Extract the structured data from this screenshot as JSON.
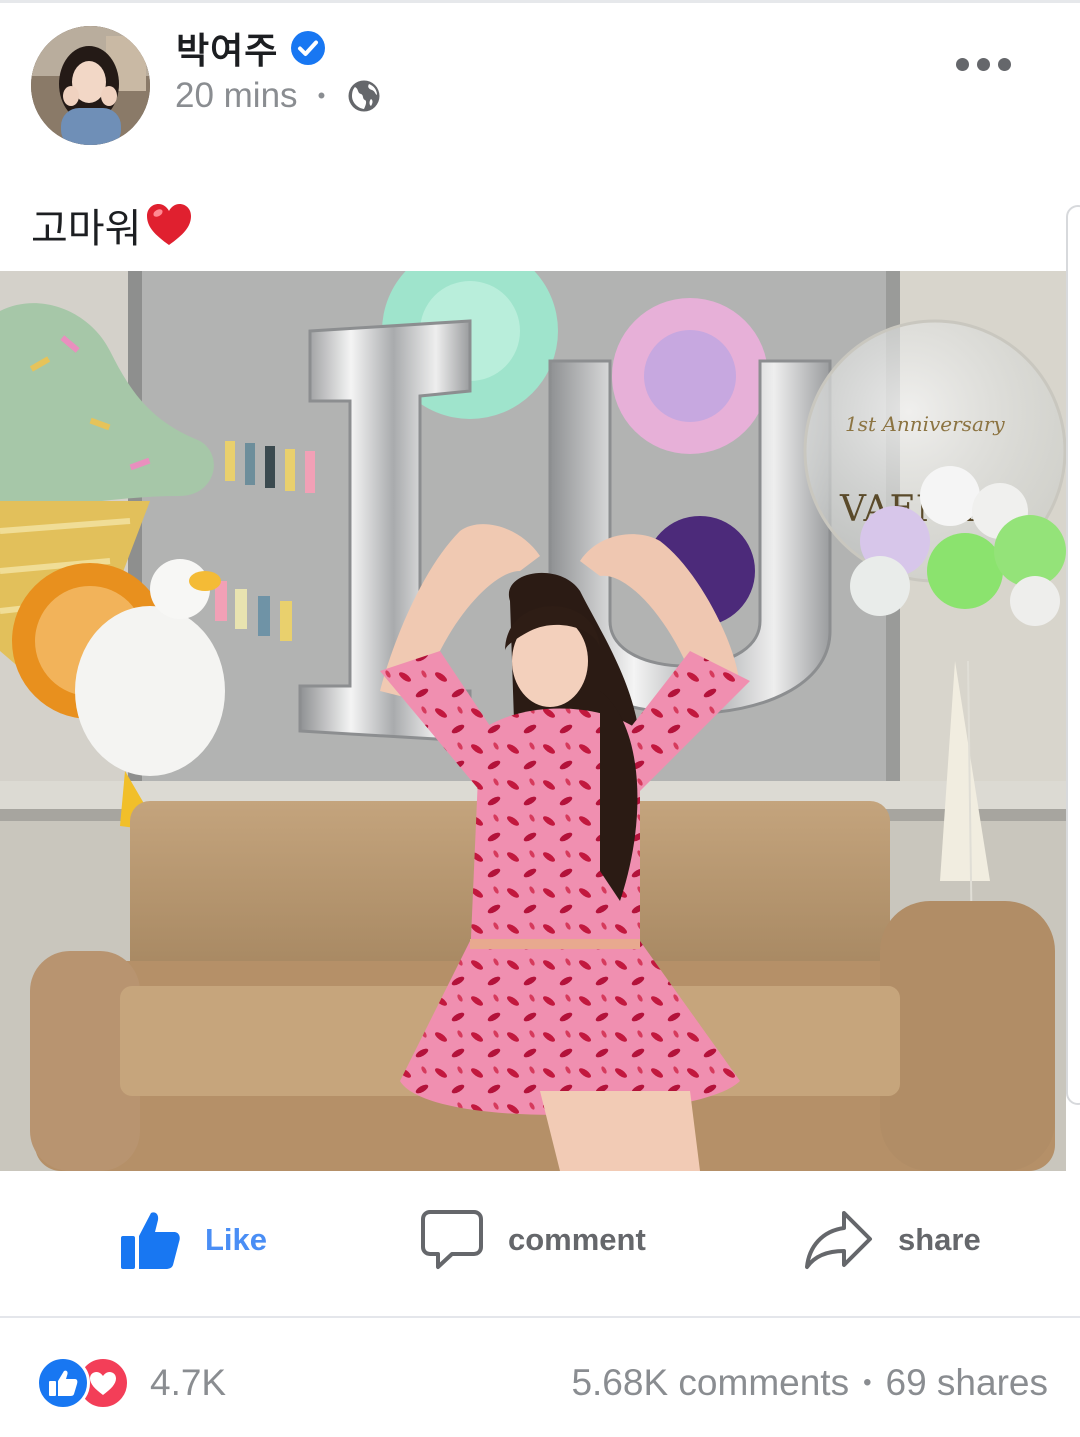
{
  "post": {
    "author": "박여주",
    "verified": true,
    "time": "20 mins",
    "separator": "•",
    "audience_icon": "globe-icon",
    "menu_icon": "more-dots-icon",
    "caption": "고마워",
    "caption_emoji": "red-heart-emoji",
    "photo": {
      "balloon_text": "VAENA",
      "balloon_subtext": "1st Anniversary"
    }
  },
  "actions": {
    "like_label": "Like",
    "comment_label": "comment",
    "share_label": "share"
  },
  "stats": {
    "reaction_count": "4.7K",
    "comments": "5.68K comments",
    "separator": "•",
    "shares": "69 shares"
  },
  "colors": {
    "accent": "#4a8ef5",
    "verified": "#1877f2",
    "love": "#f33e58",
    "muted": "#8a8d91"
  }
}
